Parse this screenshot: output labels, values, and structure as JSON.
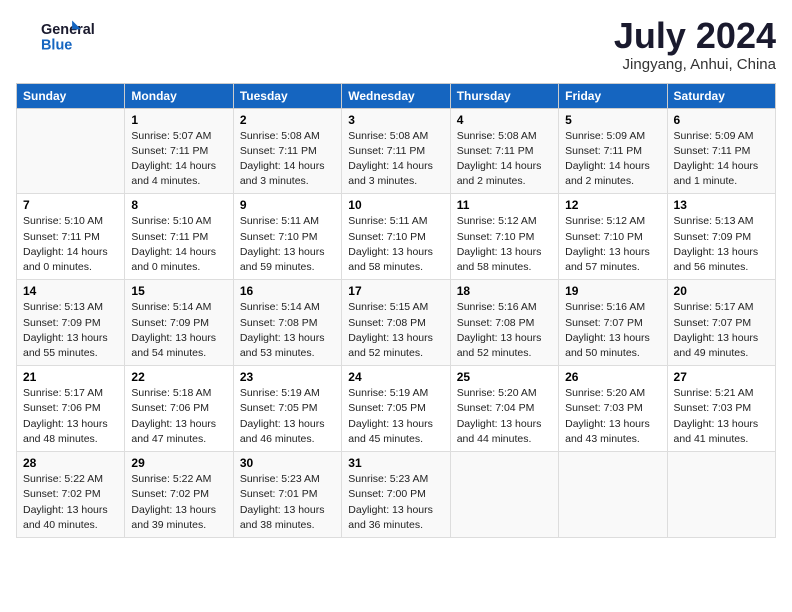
{
  "header": {
    "logo_line1": "General",
    "logo_line2": "Blue",
    "month_title": "July 2024",
    "location": "Jingyang, Anhui, China"
  },
  "days_of_week": [
    "Sunday",
    "Monday",
    "Tuesday",
    "Wednesday",
    "Thursday",
    "Friday",
    "Saturday"
  ],
  "weeks": [
    [
      {
        "day": "",
        "sunrise": "",
        "sunset": "",
        "daylight": ""
      },
      {
        "day": "1",
        "sunrise": "Sunrise: 5:07 AM",
        "sunset": "Sunset: 7:11 PM",
        "daylight": "Daylight: 14 hours and 4 minutes."
      },
      {
        "day": "2",
        "sunrise": "Sunrise: 5:08 AM",
        "sunset": "Sunset: 7:11 PM",
        "daylight": "Daylight: 14 hours and 3 minutes."
      },
      {
        "day": "3",
        "sunrise": "Sunrise: 5:08 AM",
        "sunset": "Sunset: 7:11 PM",
        "daylight": "Daylight: 14 hours and 3 minutes."
      },
      {
        "day": "4",
        "sunrise": "Sunrise: 5:08 AM",
        "sunset": "Sunset: 7:11 PM",
        "daylight": "Daylight: 14 hours and 2 minutes."
      },
      {
        "day": "5",
        "sunrise": "Sunrise: 5:09 AM",
        "sunset": "Sunset: 7:11 PM",
        "daylight": "Daylight: 14 hours and 2 minutes."
      },
      {
        "day": "6",
        "sunrise": "Sunrise: 5:09 AM",
        "sunset": "Sunset: 7:11 PM",
        "daylight": "Daylight: 14 hours and 1 minute."
      }
    ],
    [
      {
        "day": "7",
        "sunrise": "Sunrise: 5:10 AM",
        "sunset": "Sunset: 7:11 PM",
        "daylight": "Daylight: 14 hours and 0 minutes."
      },
      {
        "day": "8",
        "sunrise": "Sunrise: 5:10 AM",
        "sunset": "Sunset: 7:11 PM",
        "daylight": "Daylight: 14 hours and 0 minutes."
      },
      {
        "day": "9",
        "sunrise": "Sunrise: 5:11 AM",
        "sunset": "Sunset: 7:10 PM",
        "daylight": "Daylight: 13 hours and 59 minutes."
      },
      {
        "day": "10",
        "sunrise": "Sunrise: 5:11 AM",
        "sunset": "Sunset: 7:10 PM",
        "daylight": "Daylight: 13 hours and 58 minutes."
      },
      {
        "day": "11",
        "sunrise": "Sunrise: 5:12 AM",
        "sunset": "Sunset: 7:10 PM",
        "daylight": "Daylight: 13 hours and 58 minutes."
      },
      {
        "day": "12",
        "sunrise": "Sunrise: 5:12 AM",
        "sunset": "Sunset: 7:10 PM",
        "daylight": "Daylight: 13 hours and 57 minutes."
      },
      {
        "day": "13",
        "sunrise": "Sunrise: 5:13 AM",
        "sunset": "Sunset: 7:09 PM",
        "daylight": "Daylight: 13 hours and 56 minutes."
      }
    ],
    [
      {
        "day": "14",
        "sunrise": "Sunrise: 5:13 AM",
        "sunset": "Sunset: 7:09 PM",
        "daylight": "Daylight: 13 hours and 55 minutes."
      },
      {
        "day": "15",
        "sunrise": "Sunrise: 5:14 AM",
        "sunset": "Sunset: 7:09 PM",
        "daylight": "Daylight: 13 hours and 54 minutes."
      },
      {
        "day": "16",
        "sunrise": "Sunrise: 5:14 AM",
        "sunset": "Sunset: 7:08 PM",
        "daylight": "Daylight: 13 hours and 53 minutes."
      },
      {
        "day": "17",
        "sunrise": "Sunrise: 5:15 AM",
        "sunset": "Sunset: 7:08 PM",
        "daylight": "Daylight: 13 hours and 52 minutes."
      },
      {
        "day": "18",
        "sunrise": "Sunrise: 5:16 AM",
        "sunset": "Sunset: 7:08 PM",
        "daylight": "Daylight: 13 hours and 52 minutes."
      },
      {
        "day": "19",
        "sunrise": "Sunrise: 5:16 AM",
        "sunset": "Sunset: 7:07 PM",
        "daylight": "Daylight: 13 hours and 50 minutes."
      },
      {
        "day": "20",
        "sunrise": "Sunrise: 5:17 AM",
        "sunset": "Sunset: 7:07 PM",
        "daylight": "Daylight: 13 hours and 49 minutes."
      }
    ],
    [
      {
        "day": "21",
        "sunrise": "Sunrise: 5:17 AM",
        "sunset": "Sunset: 7:06 PM",
        "daylight": "Daylight: 13 hours and 48 minutes."
      },
      {
        "day": "22",
        "sunrise": "Sunrise: 5:18 AM",
        "sunset": "Sunset: 7:06 PM",
        "daylight": "Daylight: 13 hours and 47 minutes."
      },
      {
        "day": "23",
        "sunrise": "Sunrise: 5:19 AM",
        "sunset": "Sunset: 7:05 PM",
        "daylight": "Daylight: 13 hours and 46 minutes."
      },
      {
        "day": "24",
        "sunrise": "Sunrise: 5:19 AM",
        "sunset": "Sunset: 7:05 PM",
        "daylight": "Daylight: 13 hours and 45 minutes."
      },
      {
        "day": "25",
        "sunrise": "Sunrise: 5:20 AM",
        "sunset": "Sunset: 7:04 PM",
        "daylight": "Daylight: 13 hours and 44 minutes."
      },
      {
        "day": "26",
        "sunrise": "Sunrise: 5:20 AM",
        "sunset": "Sunset: 7:03 PM",
        "daylight": "Daylight: 13 hours and 43 minutes."
      },
      {
        "day": "27",
        "sunrise": "Sunrise: 5:21 AM",
        "sunset": "Sunset: 7:03 PM",
        "daylight": "Daylight: 13 hours and 41 minutes."
      }
    ],
    [
      {
        "day": "28",
        "sunrise": "Sunrise: 5:22 AM",
        "sunset": "Sunset: 7:02 PM",
        "daylight": "Daylight: 13 hours and 40 minutes."
      },
      {
        "day": "29",
        "sunrise": "Sunrise: 5:22 AM",
        "sunset": "Sunset: 7:02 PM",
        "daylight": "Daylight: 13 hours and 39 minutes."
      },
      {
        "day": "30",
        "sunrise": "Sunrise: 5:23 AM",
        "sunset": "Sunset: 7:01 PM",
        "daylight": "Daylight: 13 hours and 38 minutes."
      },
      {
        "day": "31",
        "sunrise": "Sunrise: 5:23 AM",
        "sunset": "Sunset: 7:00 PM",
        "daylight": "Daylight: 13 hours and 36 minutes."
      },
      {
        "day": "",
        "sunrise": "",
        "sunset": "",
        "daylight": ""
      },
      {
        "day": "",
        "sunrise": "",
        "sunset": "",
        "daylight": ""
      },
      {
        "day": "",
        "sunrise": "",
        "sunset": "",
        "daylight": ""
      }
    ]
  ]
}
